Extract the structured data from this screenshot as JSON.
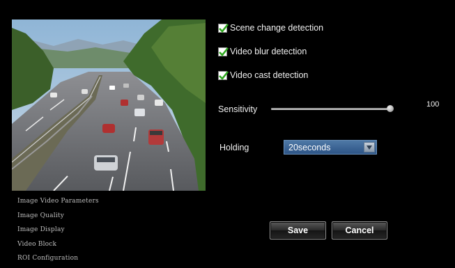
{
  "menu": {
    "items": [
      {
        "label": "Image Video Parameters"
      },
      {
        "label": "Image Quality"
      },
      {
        "label": "Image Display"
      },
      {
        "label": "Video Block"
      },
      {
        "label": "ROI Configuration"
      }
    ]
  },
  "detection": {
    "scene_change": {
      "label": "Scene change detection",
      "checked": true
    },
    "video_blur": {
      "label": "Video blur detection",
      "checked": true
    },
    "video_cast": {
      "label": "Video cast detection",
      "checked": true
    }
  },
  "sensitivity": {
    "label": "Sensitivity",
    "value": "100",
    "max": 100
  },
  "holding": {
    "label": "Holding",
    "selected": "20seconds"
  },
  "buttons": {
    "save": "Save",
    "cancel": "Cancel"
  },
  "colors": {
    "checkbox_check": "#2fa81f",
    "select_bg": "#3b6596",
    "background": "#000000"
  },
  "preview": {
    "icon": "camera-preview-image"
  }
}
